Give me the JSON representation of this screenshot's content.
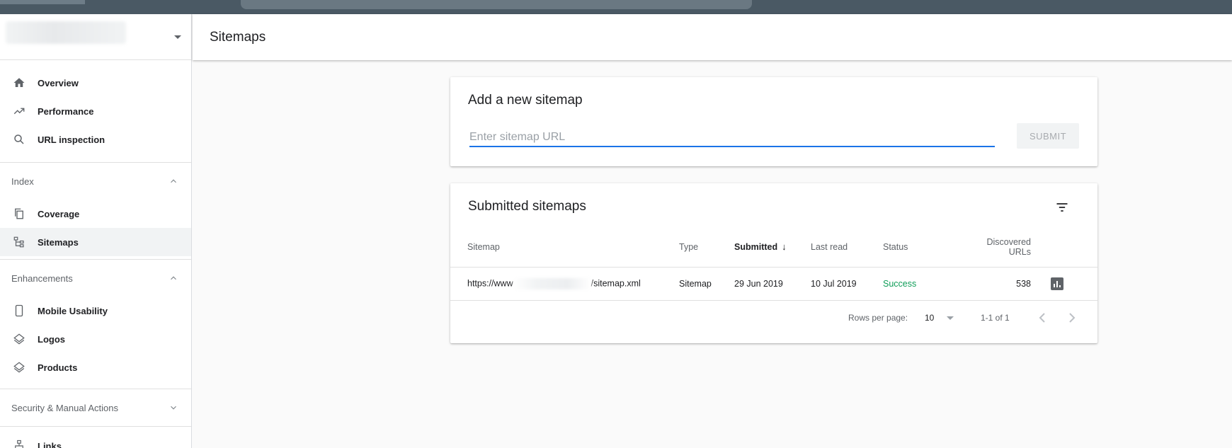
{
  "header": {
    "title": "Sitemaps"
  },
  "sidebar": {
    "top_items": [
      {
        "label": "Overview",
        "icon": "home-icon"
      },
      {
        "label": "Performance",
        "icon": "trending-up-icon"
      },
      {
        "label": "URL inspection",
        "icon": "search-icon"
      }
    ],
    "sections": [
      {
        "label": "Index",
        "expanded": true,
        "items": [
          {
            "label": "Coverage",
            "icon": "copy-icon"
          },
          {
            "label": "Sitemaps",
            "icon": "sitemap-icon",
            "active": true
          }
        ]
      },
      {
        "label": "Enhancements",
        "expanded": true,
        "items": [
          {
            "label": "Mobile Usability",
            "icon": "phone-icon"
          },
          {
            "label": "Logos",
            "icon": "layers-icon"
          },
          {
            "label": "Products",
            "icon": "layers-icon"
          }
        ]
      },
      {
        "label": "Security & Manual Actions",
        "expanded": false,
        "items": []
      }
    ],
    "bottom_items": [
      {
        "label": "Links",
        "icon": "links-icon"
      }
    ]
  },
  "add_card": {
    "title": "Add a new sitemap",
    "input_placeholder": "Enter sitemap URL",
    "submit_label": "SUBMIT"
  },
  "submitted_card": {
    "title": "Submitted sitemaps",
    "columns": [
      "Sitemap",
      "Type",
      "Submitted",
      "Last read",
      "Status",
      "Discovered URLs"
    ],
    "rows": [
      {
        "sitemap_prefix": "https://www",
        "sitemap_suffix": "/sitemap.xml",
        "type": "Sitemap",
        "submitted": "29 Jun 2019",
        "last_read": "10 Jul 2019",
        "status": "Success",
        "discovered": "538"
      }
    ],
    "pager": {
      "rows_per_page_label": "Rows per page:",
      "rows_per_page": "10",
      "range": "1-1 of 1"
    }
  },
  "colors": {
    "accent": "#1a73e8",
    "success": "#0f9d58",
    "topbar": "#4a5964"
  }
}
